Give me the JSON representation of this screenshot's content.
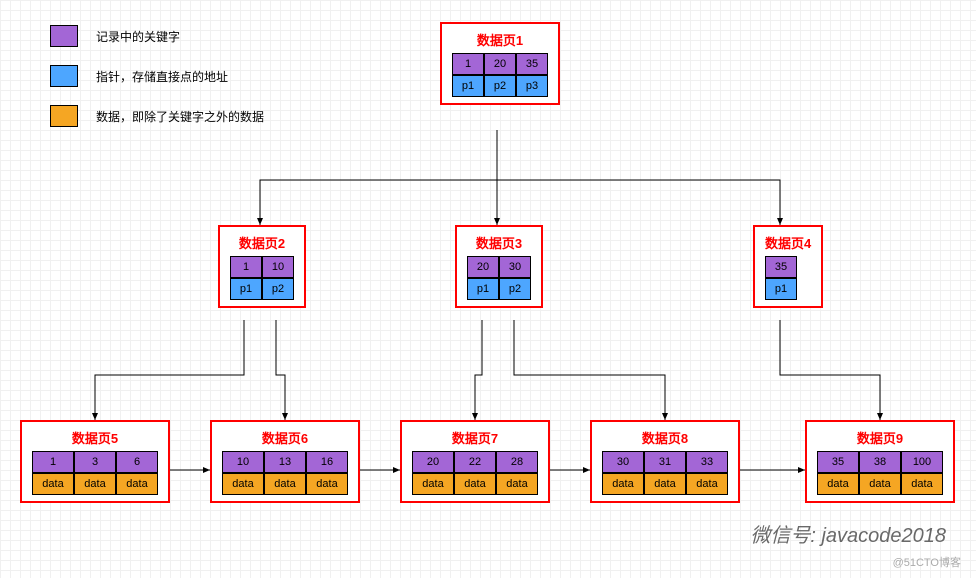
{
  "legend": {
    "key": "记录中的关键字",
    "ptr": "指针，存储直接点的地址",
    "data": "数据，即除了关键字之外的数据"
  },
  "pages": {
    "p1": {
      "title": "数据页1",
      "keys": [
        "1",
        "20",
        "35"
      ],
      "ptrs": [
        "p1",
        "p2",
        "p3"
      ]
    },
    "p2": {
      "title": "数据页2",
      "keys": [
        "1",
        "10"
      ],
      "ptrs": [
        "p1",
        "p2"
      ]
    },
    "p3": {
      "title": "数据页3",
      "keys": [
        "20",
        "30"
      ],
      "ptrs": [
        "p1",
        "p2"
      ]
    },
    "p4": {
      "title": "数据页4",
      "keys": [
        "35"
      ],
      "ptrs": [
        "p1"
      ]
    },
    "p5": {
      "title": "数据页5",
      "keys": [
        "1",
        "3",
        "6"
      ],
      "data": [
        "data",
        "data",
        "data"
      ]
    },
    "p6": {
      "title": "数据页6",
      "keys": [
        "10",
        "13",
        "16"
      ],
      "data": [
        "data",
        "data",
        "data"
      ]
    },
    "p7": {
      "title": "数据页7",
      "keys": [
        "20",
        "22",
        "28"
      ],
      "data": [
        "data",
        "data",
        "data"
      ]
    },
    "p8": {
      "title": "数据页8",
      "keys": [
        "30",
        "31",
        "33"
      ],
      "data": [
        "data",
        "data",
        "data"
      ]
    },
    "p9": {
      "title": "数据页9",
      "keys": [
        "35",
        "38",
        "100"
      ],
      "data": [
        "data",
        "data",
        "data"
      ]
    }
  },
  "watermark": "微信号: javacode2018",
  "attribution": "@51CTO博客",
  "chart_data": {
    "type": "tree",
    "description": "B+ tree index structure with 3 levels",
    "root": {
      "id": "数据页1",
      "keys": [
        1,
        20,
        35
      ],
      "pointers": [
        "p1",
        "p2",
        "p3"
      ]
    },
    "internal": [
      {
        "id": "数据页2",
        "keys": [
          1,
          10
        ],
        "pointers": [
          "p1",
          "p2"
        ],
        "parent": "数据页1"
      },
      {
        "id": "数据页3",
        "keys": [
          20,
          30
        ],
        "pointers": [
          "p1",
          "p2"
        ],
        "parent": "数据页1"
      },
      {
        "id": "数据页4",
        "keys": [
          35
        ],
        "pointers": [
          "p1"
        ],
        "parent": "数据页1"
      }
    ],
    "leaves": [
      {
        "id": "数据页5",
        "keys": [
          1,
          3,
          6
        ],
        "parent": "数据页2",
        "next": "数据页6"
      },
      {
        "id": "数据页6",
        "keys": [
          10,
          13,
          16
        ],
        "parent": "数据页2",
        "next": "数据页7"
      },
      {
        "id": "数据页7",
        "keys": [
          20,
          22,
          28
        ],
        "parent": "数据页3",
        "next": "数据页8"
      },
      {
        "id": "数据页8",
        "keys": [
          30,
          31,
          33
        ],
        "parent": "数据页3",
        "next": "数据页9"
      },
      {
        "id": "数据页9",
        "keys": [
          35,
          38,
          100
        ],
        "parent": "数据页4",
        "next": null
      }
    ]
  }
}
